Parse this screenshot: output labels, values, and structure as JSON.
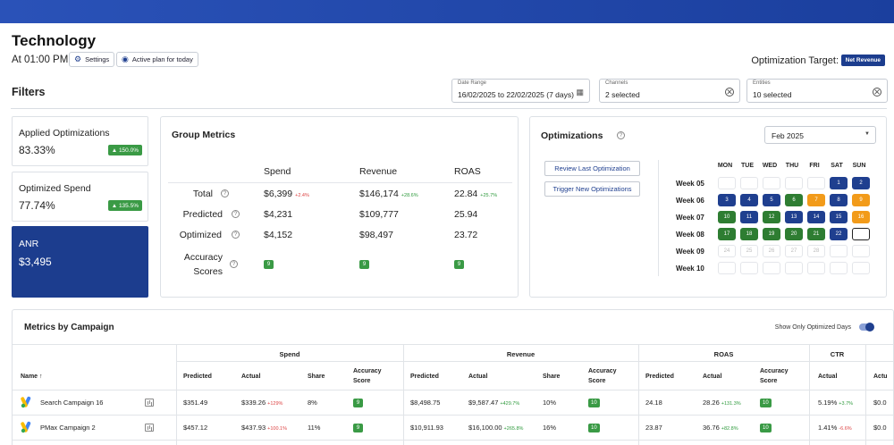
{
  "header": {
    "title": "Technology",
    "time": "At 01:00 PM",
    "settings_label": "Settings",
    "active_plan_label": "Active plan for today",
    "optimization_target_label": "Optimization Target:",
    "optimization_target_value": "Net Revenue"
  },
  "filters": {
    "title": "Filters",
    "date_range": {
      "label": "Date Range",
      "value": "16/02/2025 to 22/02/2025 (7 days)"
    },
    "channels": {
      "label": "Channels",
      "value": "2 selected"
    },
    "entities": {
      "label": "Entities",
      "value": "10 selected"
    }
  },
  "kpis": [
    {
      "name": "Applied Optimizations",
      "value": "83.33%",
      "badge": "▲ 150.0%"
    },
    {
      "name": "Optimized Spend",
      "value": "77.74%",
      "badge": "▲ 135.5%"
    },
    {
      "name": "ANR",
      "value": "$3,495"
    }
  ],
  "group_metrics": {
    "title": "Group Metrics",
    "columns": [
      "Spend",
      "Revenue",
      "ROAS"
    ],
    "rows": [
      {
        "label": "Total",
        "spend": "$6,399",
        "spend_delta": "+2.4%",
        "revenue": "$146,174",
        "revenue_delta": "+28.6%",
        "roas": "22.84",
        "roas_delta": "+25.7%"
      },
      {
        "label": "Predicted",
        "spend": "$4,231",
        "revenue": "$109,777",
        "roas": "25.94"
      },
      {
        "label": "Optimized",
        "spend": "$4,152",
        "revenue": "$98,497",
        "roas": "23.72"
      },
      {
        "label_line1": "Accuracy",
        "label_line2": "Scores",
        "spend": "9",
        "revenue": "9",
        "roas": "9"
      }
    ]
  },
  "optimizations": {
    "title": "Optimizations",
    "month": "Feb 2025",
    "review_button": "Review Last Optimization",
    "trigger_button": "Trigger New Optimizations",
    "days_of_week": [
      "MON",
      "TUE",
      "WED",
      "THU",
      "FRI",
      "SAT",
      "SUN"
    ],
    "weeks": [
      {
        "label": "Week 05",
        "days": [
          [
            "",
            "empty"
          ],
          [
            "",
            "empty"
          ],
          [
            "",
            "empty"
          ],
          [
            "",
            "empty"
          ],
          [
            "",
            "empty"
          ],
          [
            "1",
            "navy"
          ],
          [
            "2",
            "navy"
          ]
        ]
      },
      {
        "label": "Week 06",
        "days": [
          [
            "3",
            "navy"
          ],
          [
            "4",
            "navy"
          ],
          [
            "5",
            "navy"
          ],
          [
            "6",
            "green"
          ],
          [
            "7",
            "orange"
          ],
          [
            "8",
            "navy"
          ],
          [
            "9",
            "orange"
          ]
        ]
      },
      {
        "label": "Week 07",
        "days": [
          [
            "10",
            "green"
          ],
          [
            "11",
            "navy"
          ],
          [
            "12",
            "green"
          ],
          [
            "13",
            "navy"
          ],
          [
            "14",
            "navy"
          ],
          [
            "15",
            "navy"
          ],
          [
            "16",
            "orange"
          ]
        ]
      },
      {
        "label": "Week 08",
        "days": [
          [
            "17",
            "green"
          ],
          [
            "18",
            "green"
          ],
          [
            "19",
            "green"
          ],
          [
            "20",
            "green"
          ],
          [
            "21",
            "green"
          ],
          [
            "22",
            "navy"
          ],
          [
            "",
            "selected"
          ]
        ]
      },
      {
        "label": "Week 09",
        "days": [
          [
            "24",
            "out"
          ],
          [
            "25",
            "out"
          ],
          [
            "26",
            "out"
          ],
          [
            "27",
            "out"
          ],
          [
            "28",
            "out"
          ],
          [
            "",
            "empty"
          ],
          [
            "",
            "empty"
          ]
        ]
      },
      {
        "label": "Week 10",
        "days": [
          [
            "",
            "empty"
          ],
          [
            "",
            "empty"
          ],
          [
            "",
            "empty"
          ],
          [
            "",
            "empty"
          ],
          [
            "",
            "empty"
          ],
          [
            "",
            "empty"
          ],
          [
            "",
            "empty"
          ]
        ]
      }
    ]
  },
  "campaign_table": {
    "title": "Metrics by Campaign",
    "toggle_label": "Show Only Optimized Days",
    "groups": [
      "Spend",
      "Revenue",
      "ROAS",
      "CTR"
    ],
    "name_header": "Name ↑",
    "headers": {
      "spend": [
        "Predicted",
        "Actual",
        "Share",
        "Accuracy",
        "Score"
      ],
      "revenue": [
        "Predicted",
        "Actual",
        "Share",
        "Accuracy",
        "Score"
      ],
      "roas": [
        "Predicted",
        "Actual",
        "Accuracy",
        "Score"
      ],
      "ctr": [
        "Actual"
      ],
      "next": "Actu"
    },
    "rows": [
      {
        "name": "Search Campaign 16",
        "spend_pred": "$351.49",
        "spend_actual": "$339.26",
        "spend_delta": "+129%",
        "spend_share": "8%",
        "spend_acc": "9",
        "rev_pred": "$8,498.75",
        "rev_actual": "$9,587.47",
        "rev_delta": "+429.7%",
        "rev_share": "10%",
        "rev_acc": "10",
        "roas_pred": "24.18",
        "roas_actual": "28.26",
        "roas_delta": "+131.3%",
        "roas_acc": "10",
        "ctr_actual": "5.19%",
        "ctr_delta": "+3.7%",
        "next": "$0.0"
      },
      {
        "name": "PMax Campaign 2",
        "spend_pred": "$457.12",
        "spend_actual": "$437.93",
        "spend_delta": "+100.1%",
        "spend_share": "11%",
        "spend_acc": "9",
        "rev_pred": "$10,911.93",
        "rev_actual": "$16,100.00",
        "rev_delta": "+265.8%",
        "rev_share": "16%",
        "rev_acc": "10",
        "roas_pred": "23.87",
        "roas_actual": "36.76",
        "roas_delta": "+82.8%",
        "roas_acc": "10",
        "ctr_actual": "1.41%",
        "ctr_delta": "-6.6%",
        "next": "$0.0"
      }
    ]
  },
  "colors": {
    "navy": "#1f3f8f",
    "green": "#2e7d32",
    "orange": "#f29b1a",
    "badge_green": "#3a9a45"
  }
}
